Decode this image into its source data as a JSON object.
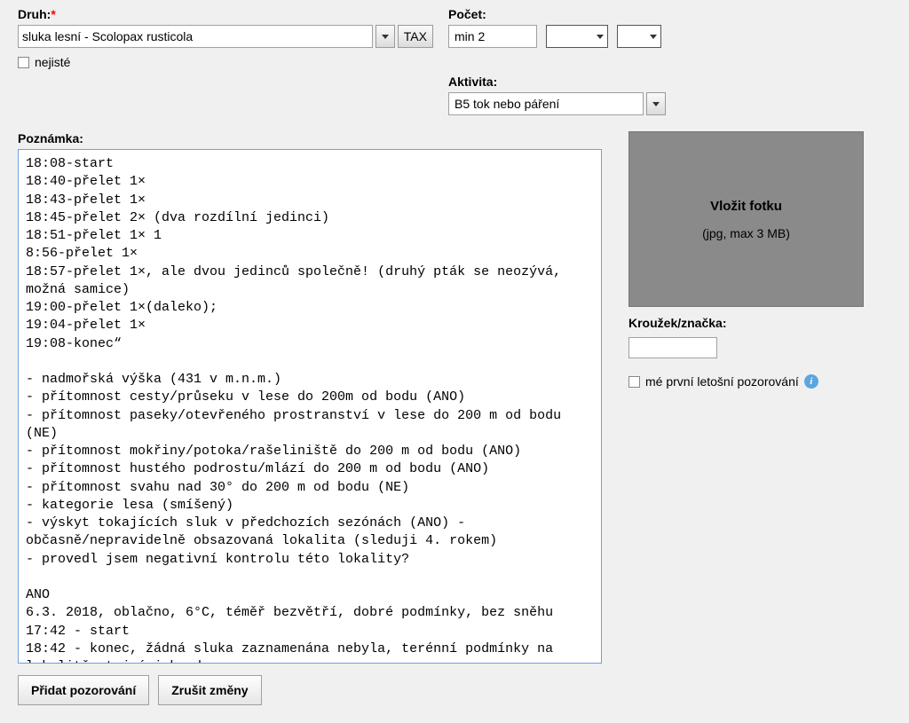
{
  "druh": {
    "label": "Druh:",
    "value": "sluka lesní - Scolopax rusticola",
    "tax_label": "TAX",
    "uncertain_label": "nejisté"
  },
  "pocet": {
    "label": "Počet:",
    "value": "min 2"
  },
  "aktivita": {
    "label": "Aktivita:",
    "value": "B5 tok nebo páření"
  },
  "poznamka": {
    "label": "Poznámka:",
    "text": "18:08-start\n18:40-přelet 1×\n18:43-přelet 1×\n18:45-přelet 2× (dva rozdílní jedinci)\n18:51-přelet 1× 1\n8:56-přelet 1×\n18:57-přelet 1×, ale dvou jedinců společně! (druhý pták se neozývá, možná samice)\n19:00-přelet 1×(daleko);\n19:04-přelet 1×\n19:08-konec“\n\n- nadmořská výška (431 v m.n.m.)\n- přítomnost cesty/průseku v lese do 200m od bodu (ANO)\n- přítomnost paseky/otevřeného prostranství v lese do 200 m od bodu (NE)\n- přítomnost mokřiny/potoka/rašeliniště do 200 m od bodu (ANO)\n- přítomnost hustého podrostu/mlází do 200 m od bodu (ANO)\n- přítomnost svahu nad 30° do 200 m od bodu (NE)\n- kategorie lesa (smíšený)\n- výskyt tokajících sluk v předchozích sezónách (ANO) - občasně/nepravidelně obsazovaná lokalita (sleduji 4. rokem)\n- provedl jsem negativní kontrolu této lokality?\n\nANO\n6.3. 2018, oblačno, 6°C, téměř bezvětří, dobré podmínky, bez sněhu\n17:42 - start\n18:42 - konec, žádná sluka zaznamenána nebyla, terénní podmínky na lokalitě stejné jako dnes"
  },
  "photo": {
    "title": "Vložit fotku",
    "subtitle": "(jpg, max 3 MB)"
  },
  "ring": {
    "label": "Kroužek/značka:",
    "value": ""
  },
  "first_obs": {
    "label": "mé první letošní pozorování"
  },
  "actions": {
    "add": "Přidat pozorování",
    "cancel": "Zrušit změny"
  }
}
